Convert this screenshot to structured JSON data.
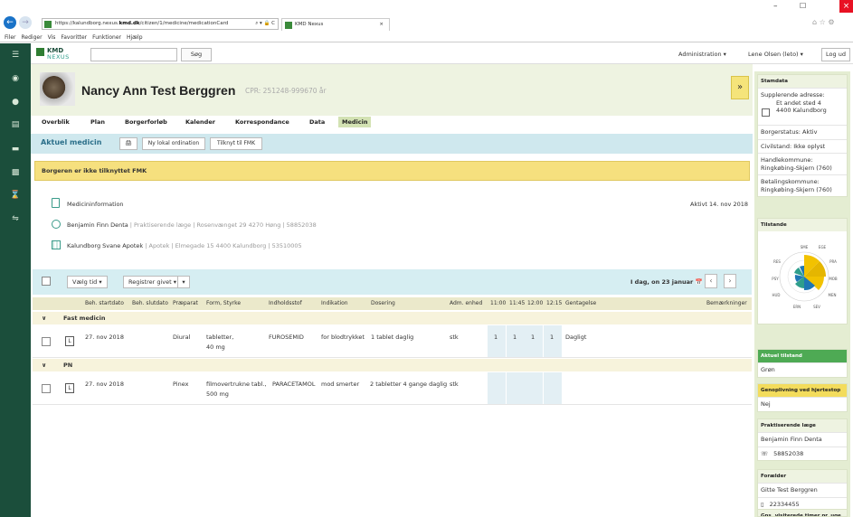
{
  "browser": {
    "url_prefix": "https://kalundborg.nexus.",
    "url_host": "kmd.dk",
    "url_rest": "/citizen/1/medicine/medicationCard",
    "url_icons": "⌕ ▾ 🔒 C",
    "tab_title": "KMD Nexus",
    "tab_close": "×",
    "menu": [
      "Filer",
      "Rediger",
      "Vis",
      "Favoritter",
      "Funktioner",
      "Hjælp"
    ],
    "win_minimize": "–",
    "win_restore": "☐",
    "win_close": "×",
    "home_icons": "⌂ ☆ ⚙"
  },
  "app": {
    "logo_top": "KMD",
    "logo_bottom": "NEXUS",
    "search_button": "Søg",
    "admin_menu": "Administration ▾",
    "user_menu": "Lene Olsen (leto) ▾",
    "logout": "Log ud"
  },
  "patient": {
    "name": "Nancy Ann Test Berggren",
    "cpr": "CPR: 251248-9996",
    "age": "70 år",
    "expand": "»"
  },
  "tabs": [
    "Overblik",
    "Plan",
    "Borgerforløb",
    "Kalender",
    "Korrespondance",
    "Data",
    "Medicin"
  ],
  "medicin": {
    "title": "Aktuel medicin",
    "print_icon": "🖨",
    "btn_lokal": "Ny lokal ordination",
    "btn_fmk": "Tilknyt til FMK",
    "fmk_warning": "Borgeren er ikke tilknyttet FMK",
    "medicininformation": "Medicininformation",
    "aktiv": "Aktivt 14. nov 2018",
    "doctor_name": "Benjamin Finn Denta",
    "doctor_detail": " | Praktiserende læge | Rosenvænget 29 4270 Høng | 58852038",
    "pharmacy_name": "Kalundborg Svane Apotek",
    "pharmacy_detail": " | Apotek | Elmegade 15 4400 Kalundborg | 53510005"
  },
  "toolbar": {
    "choose_time": "Vælg tid  ▾",
    "register": "Registrer givet  ▾",
    "today": "I dag, on 23 januar",
    "cal_icon": "📅",
    "prev": "‹",
    "next": "›"
  },
  "columns": [
    "Beh. startdato",
    "Beh. slutdato",
    "Præparat",
    "Form, Styrke",
    "Indholdsstof",
    "Indikation",
    "Dosering",
    "Adm. enhed",
    "11:00",
    "11:45",
    "12:00",
    "12:15",
    "Gentagelse",
    "Bemærkninger"
  ],
  "groups": [
    {
      "chevron": "∨",
      "name": "Fast medicin",
      "rows": [
        {
          "badge": "L",
          "start": "27. nov 2018",
          "praeparat": "Diural",
          "form1": "tabletter,",
          "form2": "40 mg",
          "indhold": "FUROSEMID",
          "indikation": "for blodtrykket",
          "dosering": "1 tablet daglig",
          "enhed": "stk",
          "t1": "1",
          "t2": "1",
          "t3": "1",
          "t4": "1",
          "gentagelse": "Dagligt"
        }
      ]
    },
    {
      "chevron": "∨",
      "name": "PN",
      "rows": [
        {
          "badge": "L",
          "start": "27. nov 2018",
          "praeparat": "Pinex",
          "form1": "filmovertrukne tabl.,",
          "form2": "500 mg",
          "indhold": "PARACETAMOL",
          "indikation": "mod smerter",
          "dosering": "2 tabletter 4 gange daglig",
          "enhed": "stk",
          "t1": "",
          "t2": "",
          "t3": "",
          "t4": "",
          "gentagelse": ""
        }
      ]
    }
  ],
  "sidebar": {
    "stamdata_title": "Stamdata",
    "supp_label": "Supplerende adresse:",
    "supp_line1": "Et andet sted 4",
    "supp_line2": "4400 Kalundborg",
    "borgerstatus": "Borgerstatus: Aktiv",
    "civilstand": "Civilstand: Ikke oplyst",
    "handle_label": "Handlekommune:",
    "handle_value": "Ringkøbing-Skjern (760)",
    "betal_label": "Betalingskommune:",
    "betal_value": "Ringkøbing-Skjern (760)",
    "tilstande_title": "Tilstande",
    "polar_labels": [
      "SME",
      "EGE",
      "PRA",
      "MOB",
      "MEN",
      "SEV",
      "ERN",
      "HUD",
      "PSY",
      "RES"
    ],
    "aktuel_title": "Aktuel tilstand",
    "aktuel_value": "Grøn",
    "genopliv_title": "Genoplivning ved hjertestop",
    "genopliv_value": "Nej",
    "laege_title": "Praktiserende læge",
    "laege_name": "Benjamin Finn Denta",
    "laege_phone": "58852038",
    "foraelder_title": "Forælder",
    "foraelder_name": "Gitte Test Berggren",
    "foraelder_phone": "22334455",
    "more_title": "Gns. visiterede timer pr. uge"
  },
  "colors": {
    "rail": "#1b4e3b",
    "accent": "#2f9e8c",
    "warning": "#f6e07e",
    "green_state": "#4eaa54"
  }
}
